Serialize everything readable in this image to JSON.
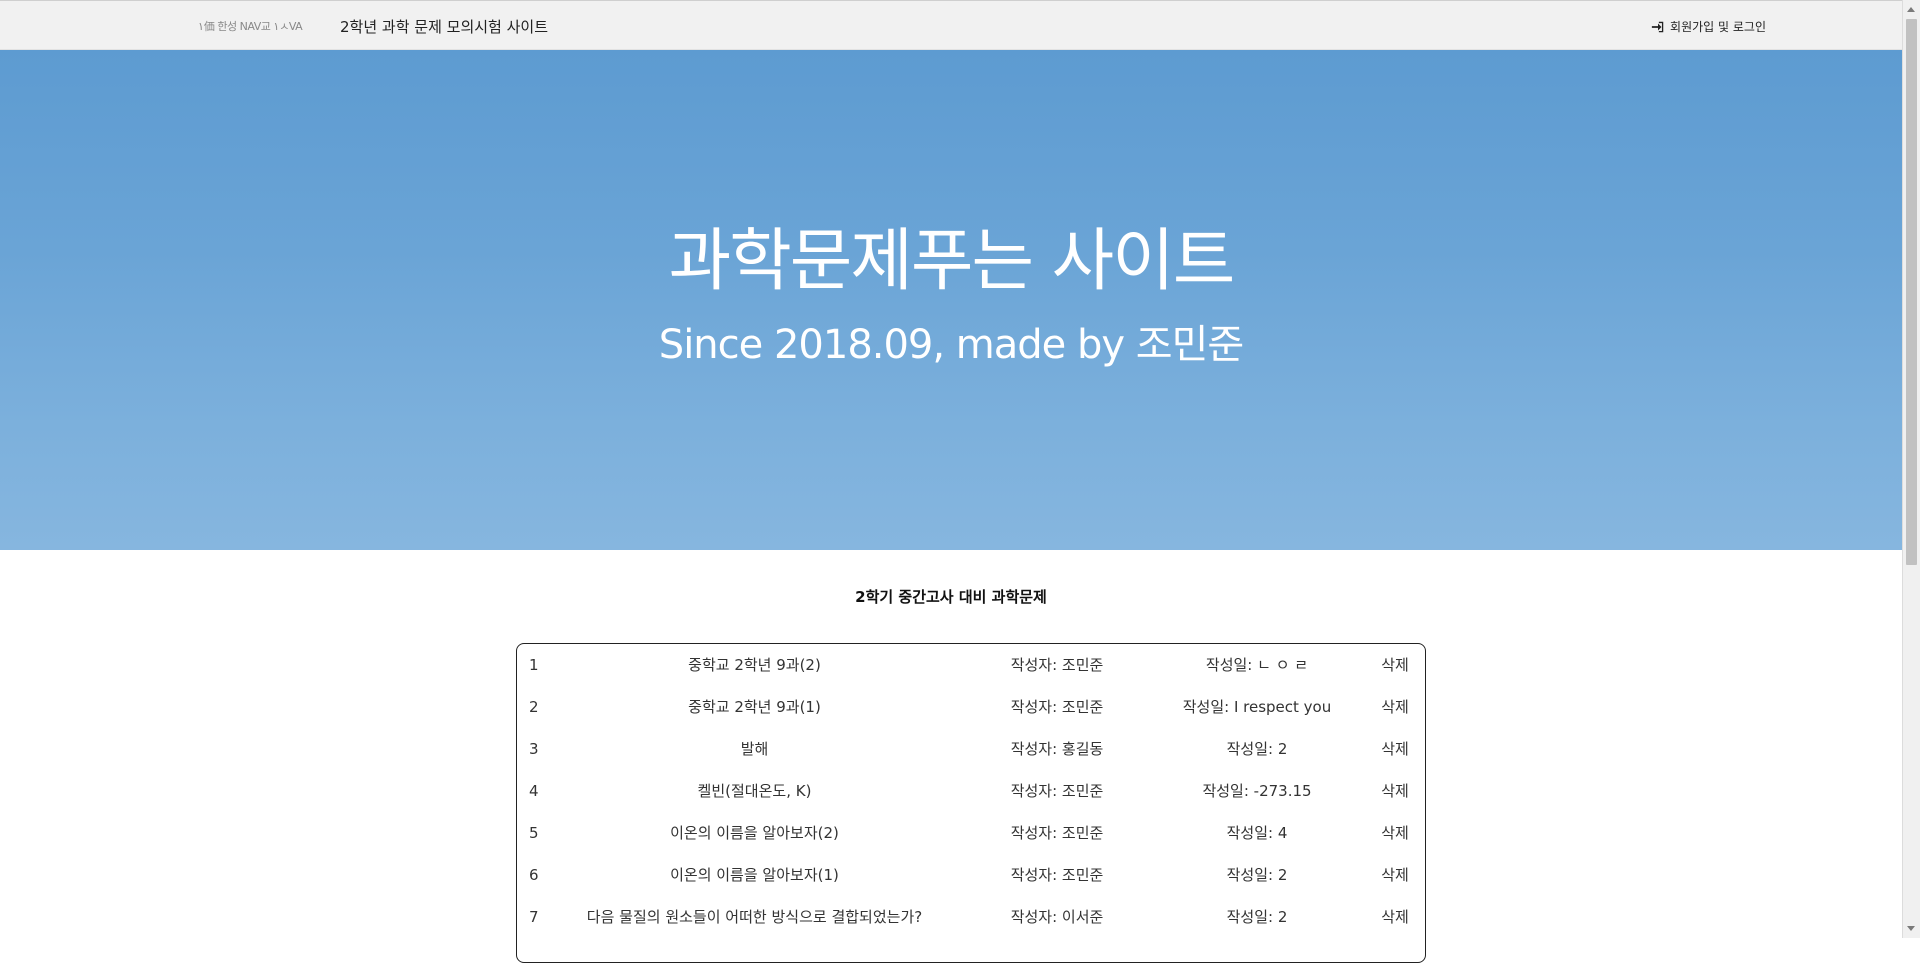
{
  "header": {
    "logo_text": "۱価 한성 NAV교   ۱ㅅVA",
    "site_title": "2학년 과학 문제 모의시험 사이트",
    "login_label": "회원가입 및 로그인",
    "login_icon": "sign-in-icon"
  },
  "hero": {
    "title": "과학문제푸는 사이트",
    "subtitle": "Since 2018.09, made by 조민준",
    "background_color": "#6aa4d6"
  },
  "section_title": "2학기 중간고사 대비 과학문제",
  "posts": [
    {
      "num": "1",
      "title": "중학교 2학년 9과(2)",
      "author": "작성자: 조민준",
      "date": "작성일: ㄴ ㅇ ㄹ",
      "delete": "삭제"
    },
    {
      "num": "2",
      "title": "중학교 2학년 9과(1)",
      "author": "작성자: 조민준",
      "date": "작성일: I respect you",
      "delete": "삭제"
    },
    {
      "num": "3",
      "title": "발해",
      "author": "작성자: 홍길동",
      "date": "작성일: 2",
      "delete": "삭제"
    },
    {
      "num": "4",
      "title": "켈빈(절대온도, K)",
      "author": "작성자: 조민준",
      "date": "작성일: -273.15",
      "delete": "삭제"
    },
    {
      "num": "5",
      "title": "이온의 이름을 알아보자(2)",
      "author": "작성자: 조민준",
      "date": "작성일: 4",
      "delete": "삭제"
    },
    {
      "num": "6",
      "title": "이온의 이름을 알아보자(1)",
      "author": "작성자: 조민준",
      "date": "작성일: 2",
      "delete": "삭제"
    },
    {
      "num": "7",
      "title": "다음 물질의 원소들이 어떠한 방식으로 결합되었는가?",
      "author": "작성자: 이서준",
      "date": "작성일: 2",
      "delete": "삭제"
    }
  ]
}
